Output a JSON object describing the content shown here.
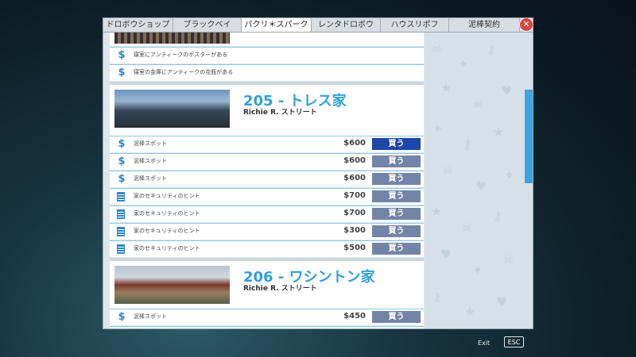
{
  "tabs": [
    {
      "label": "ドロボウショップ",
      "width": 88
    },
    {
      "label": "ブラックベイ",
      "width": 86
    },
    {
      "label": "パクリ＊スパーク",
      "width": 88
    },
    {
      "label": "レンタドロボウ",
      "width": 87
    },
    {
      "label": "ハウスリポフ",
      "width": 86
    },
    {
      "label": "泥棒契約",
      "width": 89
    }
  ],
  "active_tab": 2,
  "close_label": "✕",
  "top_rows": [
    {
      "icon": "dollar",
      "text": "寝室にアンティークのポスターがある"
    },
    {
      "icon": "dollar",
      "text": "寝室の金庫にアンティークの花瓶がある"
    }
  ],
  "houses": [
    {
      "title": "205 - トレス家",
      "street": "Richie R. ストリート",
      "rows": [
        {
          "icon": "dollar",
          "text": "泥棒スポット",
          "price": "$600",
          "buy": "買う",
          "highlight": true
        },
        {
          "icon": "dollar",
          "text": "泥棒スポット",
          "price": "$600",
          "buy": "買う"
        },
        {
          "icon": "dollar",
          "text": "泥棒スポット",
          "price": "$600",
          "buy": "買う"
        },
        {
          "icon": "doc",
          "text": "家のセキュリティのヒント",
          "price": "$700",
          "buy": "買う"
        },
        {
          "icon": "doc",
          "text": "家のセキュリティのヒント",
          "price": "$700",
          "buy": "買う"
        },
        {
          "icon": "doc",
          "text": "家のセキュリティのヒント",
          "price": "$300",
          "buy": "買う"
        },
        {
          "icon": "doc",
          "text": "家のセキュリティのヒント",
          "price": "$500",
          "buy": "買う"
        }
      ]
    },
    {
      "title": "206 - ワシントン家",
      "street": "Richie R. ストリート",
      "rows": [
        {
          "icon": "dollar",
          "text": "泥棒スポット",
          "price": "$450",
          "buy": "買う"
        }
      ]
    }
  ],
  "footer": {
    "exit_label": "Exit",
    "esc_label": "ESC"
  }
}
